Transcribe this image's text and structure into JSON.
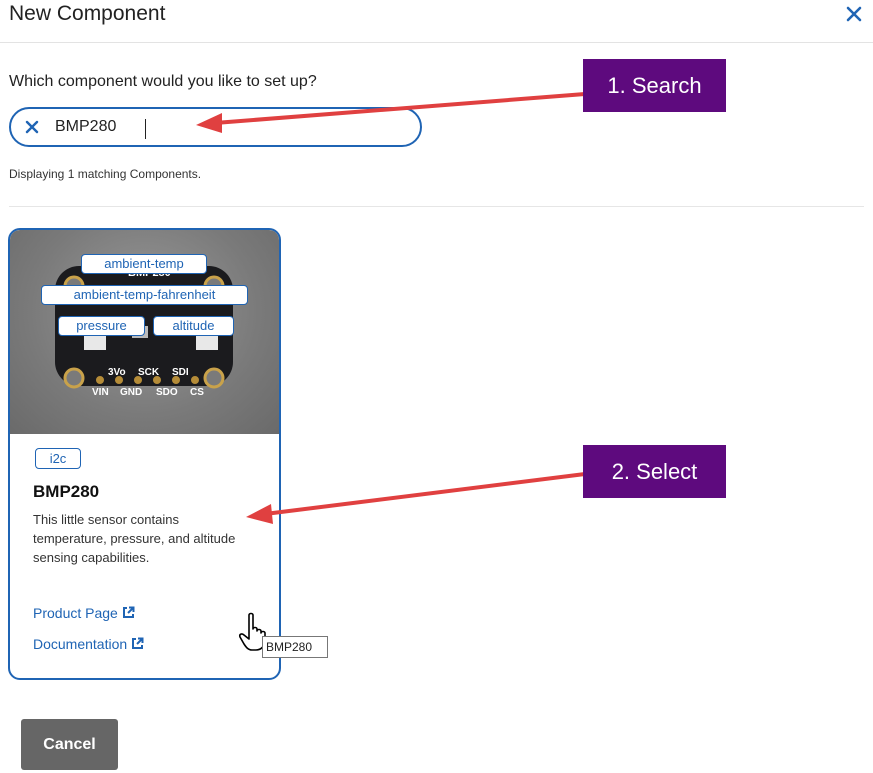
{
  "dialog": {
    "title": "New Component",
    "question": "Which component would you like to set up?",
    "search": {
      "value": "BMP280",
      "placeholder": ""
    },
    "matching_text": "Displaying 1 matching Components.",
    "cancel_label": "Cancel"
  },
  "card": {
    "image_tags": [
      "ambient-temp",
      "ambient-temp-fahrenheit",
      "pressure",
      "altitude"
    ],
    "board_labels": {
      "title": "BMP280",
      "top_row": [
        "3Vo",
        "SCK",
        "SDI"
      ],
      "bottom_row": [
        "VIN",
        "GND",
        "SDO",
        "CS"
      ]
    },
    "protocol_tag": "i2c",
    "name": "BMP280",
    "description": "This little sensor contains temperature, pressure, and altitude sensing capabilities.",
    "links": [
      "Product Page",
      "Documentation"
    ],
    "tooltip": "BMP280"
  },
  "annotations": {
    "step1": "1. Search",
    "step2": "2. Select"
  },
  "colors": {
    "accent": "#1f64b4",
    "callout": "#5e0a7e",
    "arrow": "#e04040",
    "cancel_bg": "#666666"
  },
  "icons": [
    "close-icon",
    "clear-search-icon",
    "external-link-icon",
    "hand-pointer-cursor-icon"
  ]
}
